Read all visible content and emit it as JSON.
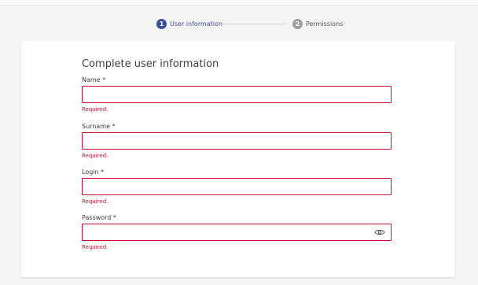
{
  "stepper": {
    "steps": [
      {
        "number": "1",
        "label": "User information",
        "state": "active"
      },
      {
        "number": "2",
        "label": "Permissions",
        "state": "inactive"
      }
    ]
  },
  "form": {
    "title": "Complete user information",
    "fields": [
      {
        "label": "Name *",
        "value": "",
        "error": "Required."
      },
      {
        "label": "Surname *",
        "value": "",
        "error": "Required."
      },
      {
        "label": "Login *",
        "value": "",
        "error": "Required."
      },
      {
        "label": "Password *",
        "value": "",
        "error": "Required.",
        "icon": "eye-icon"
      }
    ]
  },
  "colors": {
    "active_step": "#3d4f9b",
    "inactive_step": "#9e9e9e",
    "error": "#c8102e"
  }
}
